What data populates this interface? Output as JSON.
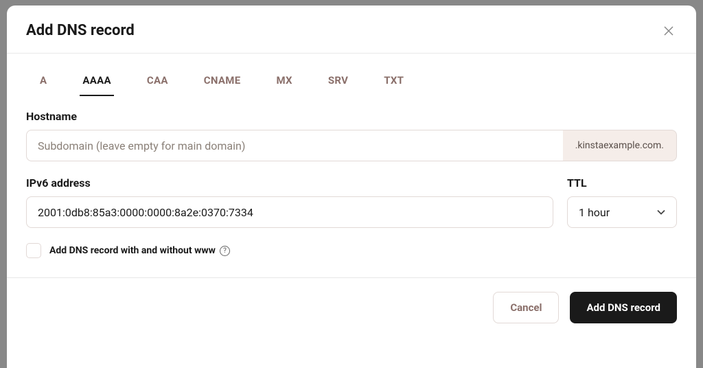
{
  "modal": {
    "title": "Add DNS record"
  },
  "tabs": [
    {
      "label": "A",
      "active": false
    },
    {
      "label": "AAAA",
      "active": true
    },
    {
      "label": "CAA",
      "active": false
    },
    {
      "label": "CNAME",
      "active": false
    },
    {
      "label": "MX",
      "active": false
    },
    {
      "label": "SRV",
      "active": false
    },
    {
      "label": "TXT",
      "active": false
    }
  ],
  "form": {
    "hostname": {
      "label": "Hostname",
      "placeholder": "Subdomain (leave empty for main domain)",
      "value": "",
      "suffix": ".kinstaexample.com."
    },
    "ipv6": {
      "label": "IPv6 address",
      "value": "2001:0db8:85a3:0000:0000:8a2e:0370:7334"
    },
    "ttl": {
      "label": "TTL",
      "value": "1 hour"
    },
    "www_checkbox": {
      "label": "Add DNS record with and without www",
      "checked": false
    }
  },
  "footer": {
    "cancel": "Cancel",
    "submit": "Add DNS record"
  }
}
